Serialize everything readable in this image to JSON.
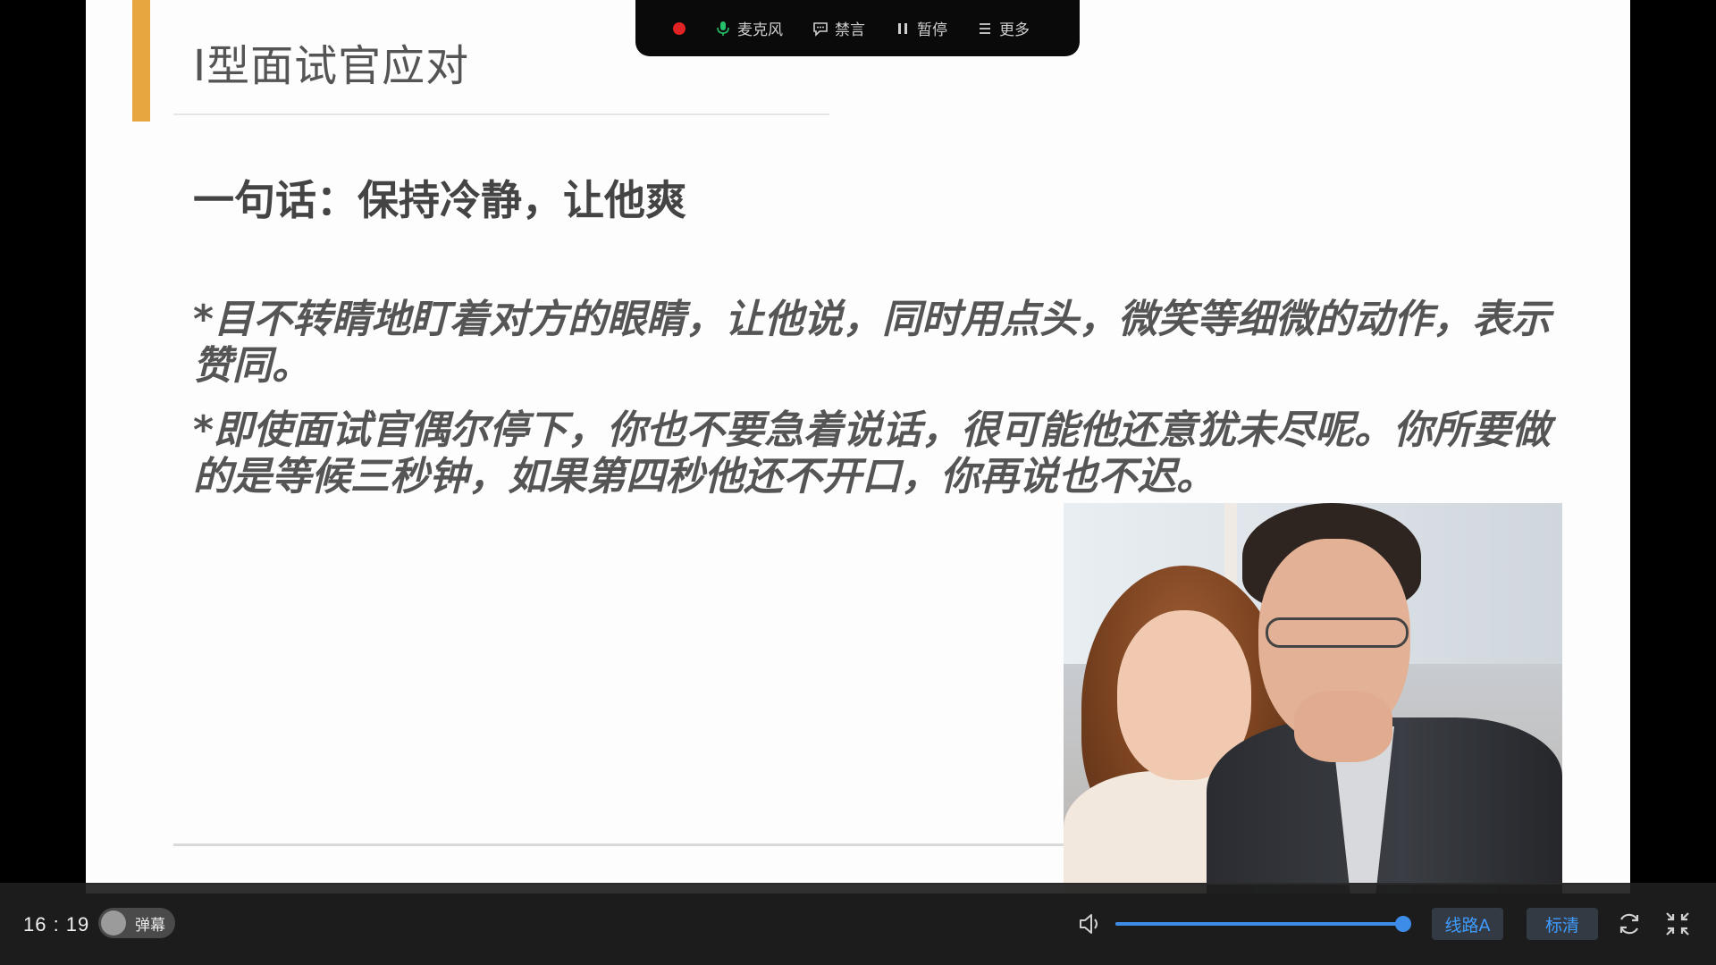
{
  "slide": {
    "title": "I型面试官应对",
    "lead": "一句话：保持冷静，让他爽",
    "bullets": [
      "*目不转睛地盯着对方的眼睛，让他说，同时用点头，微笑等细微的动作，表示赞同。",
      "*即使面试官偶尔停下，你也不要急着说话，很可能他还意犹未尽呢。你所要做的是等候三秒钟，如果第四秒他还不开口，你再说也不迟。"
    ],
    "accent_color": "#e8a640"
  },
  "toolbar": {
    "record_color": "#e32323",
    "items": [
      {
        "icon": "microphone-icon",
        "label": "麦克风"
      },
      {
        "icon": "chat-bubble-icon",
        "label": "禁言"
      },
      {
        "icon": "pause-icon",
        "label": "暂停"
      },
      {
        "icon": "menu-icon",
        "label": "更多"
      }
    ]
  },
  "controls": {
    "time": "16 : 19",
    "danmaku_label": "弹幕",
    "volume_percent": 100,
    "line_label": "线路A",
    "quality_label": "标清",
    "accent_color": "#3d8de8"
  }
}
